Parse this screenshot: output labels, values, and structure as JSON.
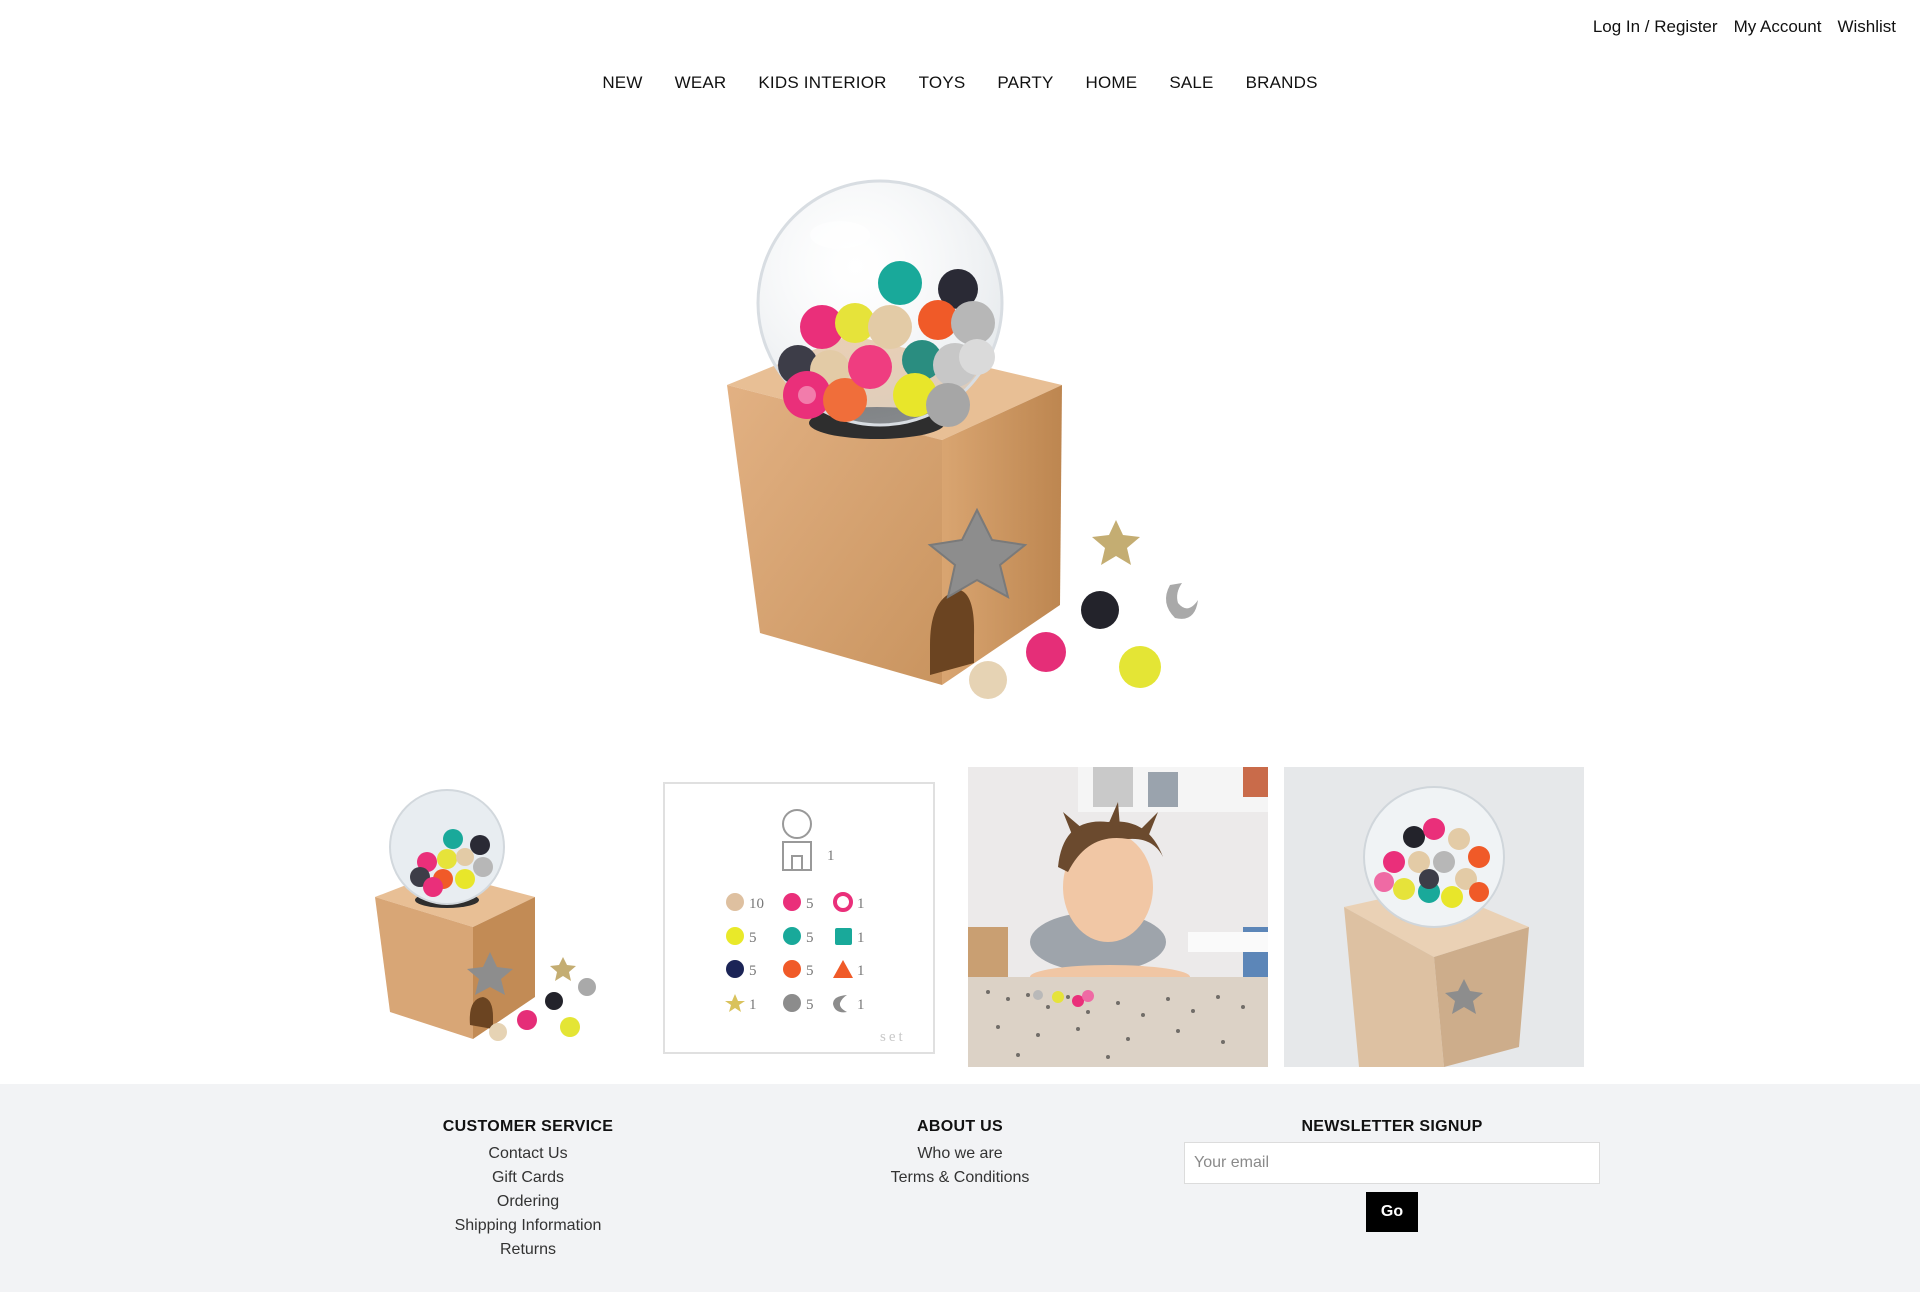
{
  "top_links": {
    "login": "Log In / Register",
    "account": "My Account",
    "wishlist": "Wishlist"
  },
  "nav": [
    "NEW",
    "WEAR",
    "KIDS INTERIOR",
    "TOYS",
    "PARTY",
    "HOME",
    "SALE",
    "BRANDS"
  ],
  "chart_card": {
    "capsule_count": "1",
    "rows": [
      [
        "10",
        "5",
        "1"
      ],
      [
        "5",
        "5",
        "1"
      ],
      [
        "5",
        "5",
        "1"
      ],
      [
        "1",
        "5",
        "1"
      ]
    ],
    "caption": "set"
  },
  "footer": {
    "customer_service": {
      "heading": "CUSTOMER SERVICE",
      "links": [
        "Contact Us",
        "Gift Cards",
        "Ordering",
        "Shipping Information",
        "Returns"
      ]
    },
    "about": {
      "heading": "ABOUT US",
      "links": [
        "Who we are",
        "Terms & Conditions"
      ]
    },
    "newsletter": {
      "heading": "NEWSLETTER SIGNUP",
      "placeholder": "Your email",
      "button": "Go"
    }
  },
  "colors": {
    "wood": "#d9a878",
    "pink": "#ea2f7a",
    "yellow": "#e6e33a",
    "teal": "#19a99a",
    "navy": "#1b2456",
    "orange": "#f05a28",
    "silver": "#a8a8a8",
    "footer_bg": "#f2f3f5"
  }
}
